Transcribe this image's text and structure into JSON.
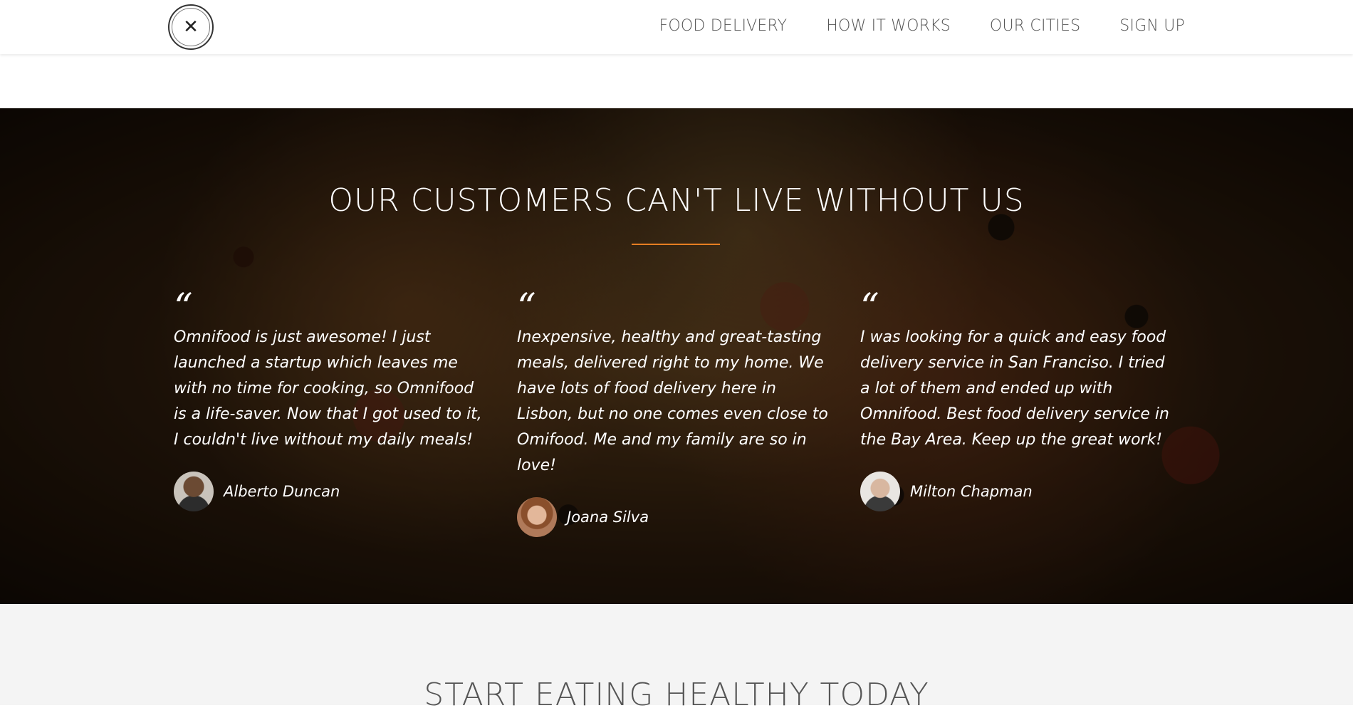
{
  "header": {
    "nav": [
      {
        "label": "FOOD DELIVERY"
      },
      {
        "label": "HOW IT WORKS"
      },
      {
        "label": "OUR CITIES"
      },
      {
        "label": "SIGN UP"
      }
    ]
  },
  "testimonials": {
    "title": "OUR CUSTOMERS CAN'T LIVE WITHOUT US",
    "items": [
      {
        "quote": "Omnifood is just awesome! I just launched a startup which leaves me with no time for cooking, so Omnifood is a life-saver. Now that I got used to it, I couldn't live without my daily meals!",
        "author": "Alberto Duncan",
        "quote_mark": "“"
      },
      {
        "quote": "Inexpensive, healthy and great-tasting meals, delivered right to my home. We have lots of food delivery here in Lisbon, but no one comes even close to Omifood. Me and my family are so in love!",
        "author": "Joana Silva",
        "quote_mark": "“"
      },
      {
        "quote": "I was looking for a quick and easy food delivery service in San Franciso. I tried a lot of them and ended up with Omnifood. Best food delivery service in the Bay Area. Keep up the great work!",
        "author": "Milton Chapman",
        "quote_mark": "“"
      }
    ]
  },
  "signup": {
    "title": "START EATING HEALTHY TODAY"
  },
  "colors": {
    "accent": "#e67e22",
    "section_bg": "#f4f4f4",
    "nav_text": "#555555"
  },
  "icons": {
    "logo": "fork-knife-logo-icon",
    "quote": "quote-mark-icon"
  }
}
